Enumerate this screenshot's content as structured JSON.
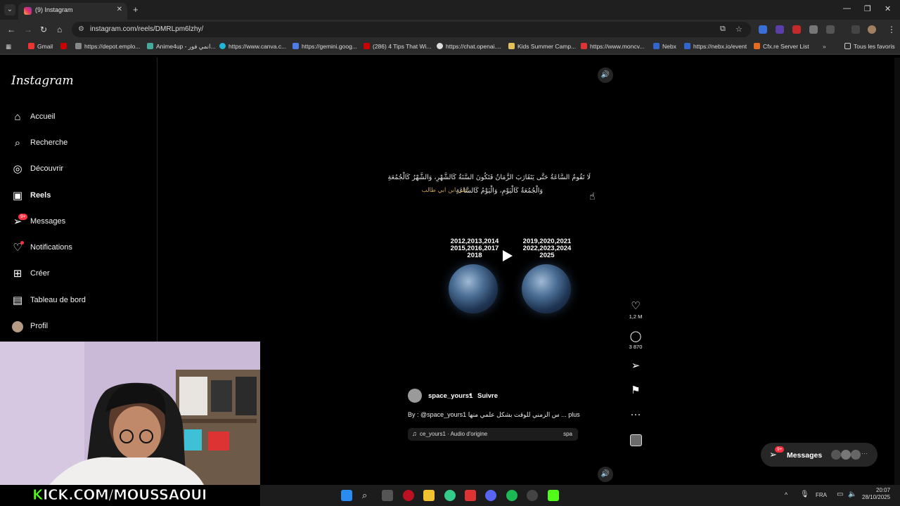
{
  "browser": {
    "tab_title": "(9) Instagram",
    "url": "instagram.com/reels/DMRLpm6lzhy/",
    "bookmarks": [
      "Gmail",
      "https://depot.emplo...",
      "Anime4up - انمي فور...",
      "https://www.canva.c...",
      "https://gemini.goog...",
      "(286) 4 Tips That Wi...",
      "https://chat.openai....",
      "Kids Summer Camp...",
      "https://www.moncv...",
      "Nebx",
      "https://nebx.io/event",
      "Cfx.re Server List"
    ],
    "all_bookmarks": "Tous les favoris"
  },
  "sidebar": {
    "logo": "Instagram",
    "items": [
      {
        "label": "Accueil"
      },
      {
        "label": "Recherche"
      },
      {
        "label": "Découvrir"
      },
      {
        "label": "Reels"
      },
      {
        "label": "Messages",
        "badge": "9+"
      },
      {
        "label": "Notifications"
      },
      {
        "label": "Créer"
      },
      {
        "label": "Tableau de bord"
      },
      {
        "label": "Profil"
      }
    ]
  },
  "reel": {
    "quote_line1": "لَا تَقُومُ السَّاعَةُ حَتَّى يَتَقَارَبَ الزَّمَانُ فَتَكُونَ السَّنَةُ كَالشَّهْرِ، وَالشَّهْرُ كَالْجُمُعَةِ",
    "quote_line2": "وَالْجُمُعَةُ كَالْيَوْمِ، وَالْيَوْمُ كَالسَّاعَةِ",
    "quote_author": "علي ابن ابي طالب",
    "years_left": [
      "2012,2013,2014",
      "2015,2016,2017",
      "2018"
    ],
    "years_right": [
      "2019,2020,2021",
      "2022,2023,2024",
      "2025"
    ],
    "likes": "1,2 M",
    "comments": "3 870",
    "author": "space_yours1",
    "follow": "Suivre",
    "caption": "By : @space_yours1 س الزمني للوقت بشكل علمي منها ... plus",
    "audio": "ce_yours1 · Audio d'origine",
    "audio_short": "spa"
  },
  "messages_pill": {
    "label": "Messages",
    "badge": "9+"
  },
  "stream": {
    "overlay": "KICK.COM/MOUSSAOUI"
  },
  "taskbar": {
    "lang": "FRA",
    "time": "20:07",
    "date": "28/10/2025"
  }
}
